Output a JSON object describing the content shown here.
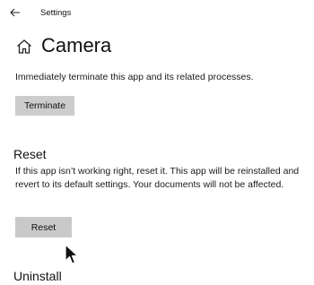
{
  "window": {
    "title": "Settings",
    "back_icon": "back-arrow-icon"
  },
  "header": {
    "home_icon": "home-icon",
    "title": "Camera"
  },
  "terminate_section": {
    "description": "Immediately terminate this app and its related processes.",
    "button_label": "Terminate"
  },
  "reset_section": {
    "heading": "Reset",
    "description": "If this app isn’t working right, reset it. This app will be reinstalled and revert to its default settings. Your documents will not be affected.",
    "button_label": "Reset"
  },
  "uninstall_section": {
    "heading": "Uninstall"
  },
  "colors": {
    "button_bg": "#cccccc",
    "background": "#ffffff",
    "text": "#1a1a1a"
  }
}
